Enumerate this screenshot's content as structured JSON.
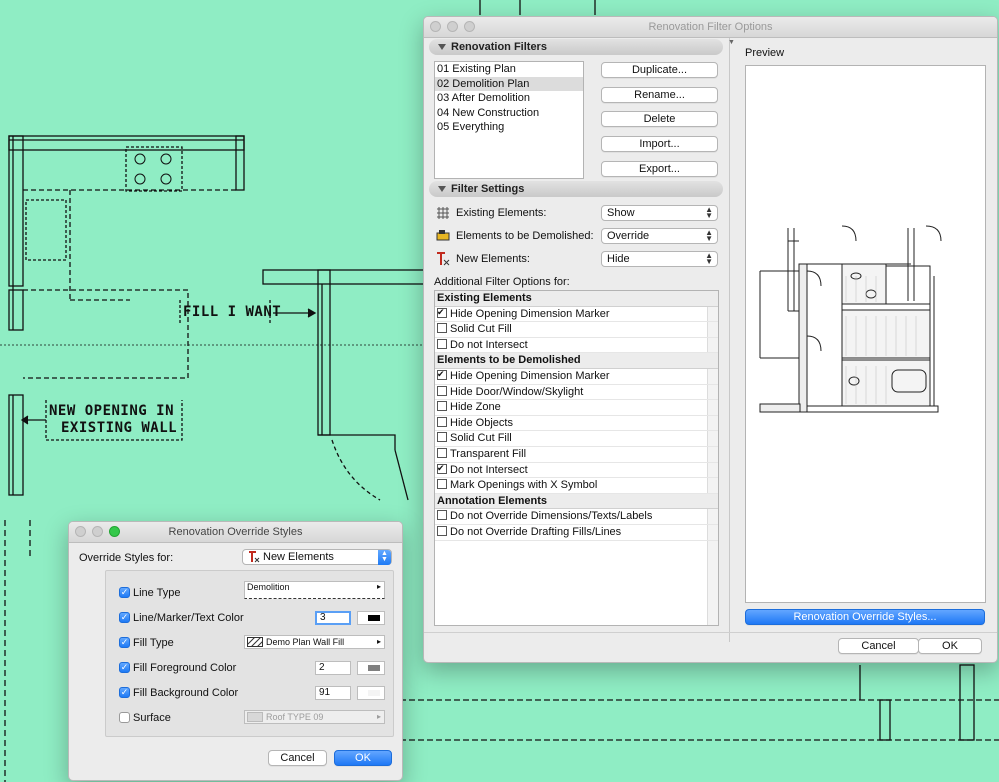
{
  "drawing": {
    "labels": {
      "fill_i_want": "FILL I WANT",
      "new_opening_line1": "NEW OPENING IN",
      "new_opening_line2": "EXISTING WALL"
    }
  },
  "filter_window": {
    "title": "Renovation Filter Options",
    "filters_section": "Renovation Filters",
    "filters": [
      "01 Existing Plan",
      "02 Demolition Plan",
      "03 After Demolition",
      "04 New Construction",
      "05 Everything"
    ],
    "selected_filter": "02 Demolition Plan",
    "buttons": {
      "duplicate": "Duplicate...",
      "rename": "Rename...",
      "delete": "Delete",
      "import": "Import...",
      "export": "Export..."
    },
    "settings_section": "Filter Settings",
    "settings": {
      "existing_label": "Existing Elements:",
      "existing_value": "Show",
      "demolished_label": "Elements to be Demolished:",
      "demolished_value": "Override",
      "new_label": "New Elements:",
      "new_value": "Hide"
    },
    "additional_label": "Additional Filter Options for:",
    "groups": [
      {
        "title": "Existing Elements",
        "items": [
          {
            "label": "Hide Opening Dimension Marker",
            "checked": true
          },
          {
            "label": "Solid Cut Fill",
            "checked": false
          },
          {
            "label": "Do not Intersect",
            "checked": false
          }
        ]
      },
      {
        "title": "Elements to be Demolished",
        "items": [
          {
            "label": "Hide Opening Dimension Marker",
            "checked": true
          },
          {
            "label": "Hide Door/Window/Skylight",
            "checked": false
          },
          {
            "label": "Hide Zone",
            "checked": false
          },
          {
            "label": "Hide Objects",
            "checked": false
          },
          {
            "label": "Solid Cut Fill",
            "checked": false
          },
          {
            "label": "Transparent Fill",
            "checked": false
          },
          {
            "label": "Do not Intersect",
            "checked": true
          },
          {
            "label": "Mark Openings with X Symbol",
            "checked": false
          }
        ]
      },
      {
        "title": "Annotation Elements",
        "items": [
          {
            "label": "Do not Override Dimensions/Texts/Labels",
            "checked": false
          },
          {
            "label": "Do not Override Drafting Fills/Lines",
            "checked": false
          }
        ]
      }
    ],
    "preview_label": "Preview",
    "override_styles_button": "Renovation Override Styles...",
    "cancel": "Cancel",
    "ok": "OK"
  },
  "override_window": {
    "title": "Renovation Override Styles",
    "override_for_label": "Override Styles for:",
    "override_for_value": "New Elements",
    "rows": {
      "line_type": {
        "label": "Line Type",
        "value": "Demolition",
        "checked": true
      },
      "line_color": {
        "label": "Line/Marker/Text Color",
        "value": "3",
        "checked": true
      },
      "fill_type": {
        "label": "Fill Type",
        "value": "Demo Plan Wall  Fill",
        "checked": true
      },
      "fill_fg": {
        "label": "Fill Foreground Color",
        "value": "2",
        "checked": true
      },
      "fill_bg": {
        "label": "Fill Background Color",
        "value": "91",
        "checked": true
      },
      "surface": {
        "label": "Surface",
        "value": "Roof TYPE 09",
        "checked": false
      }
    },
    "cancel": "Cancel",
    "ok": "OK"
  }
}
